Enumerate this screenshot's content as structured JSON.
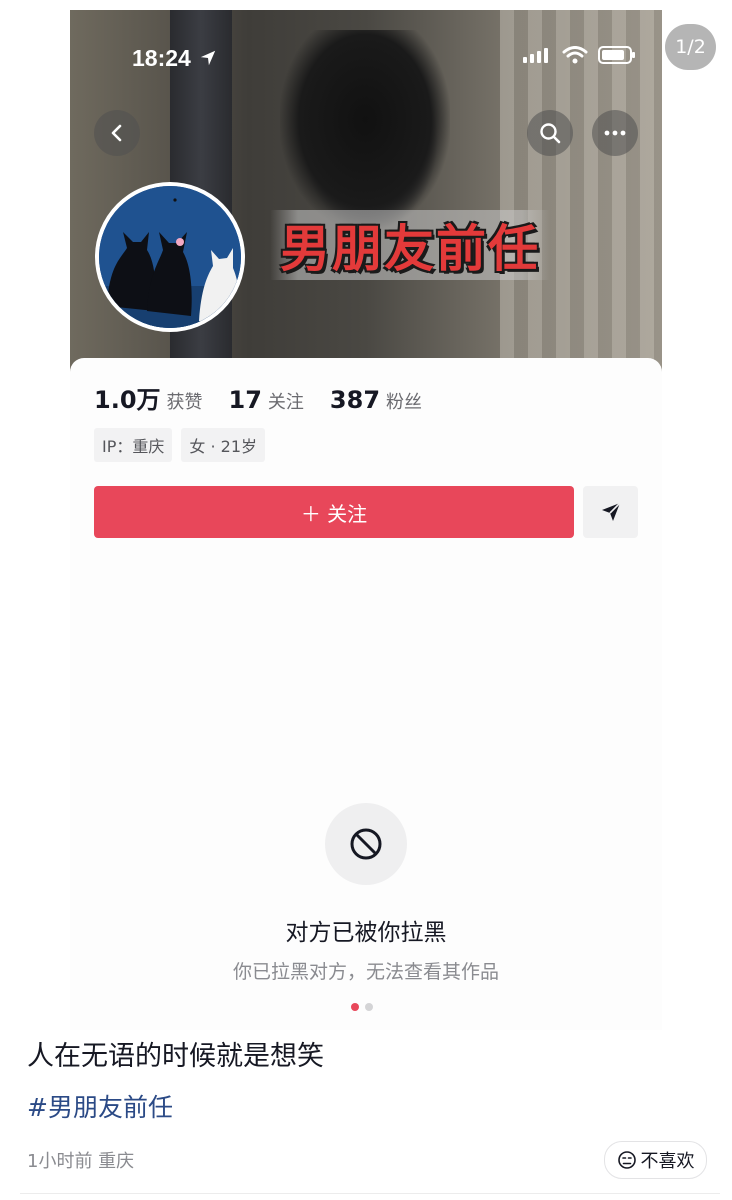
{
  "page_counter": "1/2",
  "status_bar": {
    "time": "18:24"
  },
  "banner": {
    "text": "男朋友前任"
  },
  "profile": {
    "stats": [
      {
        "value": "1.0万",
        "label": "获赞"
      },
      {
        "value": "17",
        "label": "关注"
      },
      {
        "value": "387",
        "label": "粉丝"
      }
    ],
    "tags": [
      "IP：重庆",
      "女 · 21岁"
    ],
    "follow_label": "＋ 关注"
  },
  "blocked": {
    "title": "对方已被你拉黑",
    "description": "你已拉黑对方，无法查看其作品"
  },
  "carousel": {
    "current": 1,
    "total": 2
  },
  "post": {
    "text": "人在无语的时候就是想笑",
    "hashtag": "#男朋友前任",
    "meta": "1小时前  重庆",
    "dislike_label": "不喜欢"
  },
  "colors": {
    "accent": "#e8475a",
    "hashtag": "#2b4a86"
  },
  "icons": [
    "back-icon",
    "search-icon",
    "more-icon",
    "location-arrow-icon",
    "signal-icon",
    "wifi-icon",
    "battery-icon",
    "share-icon",
    "blocked-icon",
    "dislike-icon"
  ]
}
